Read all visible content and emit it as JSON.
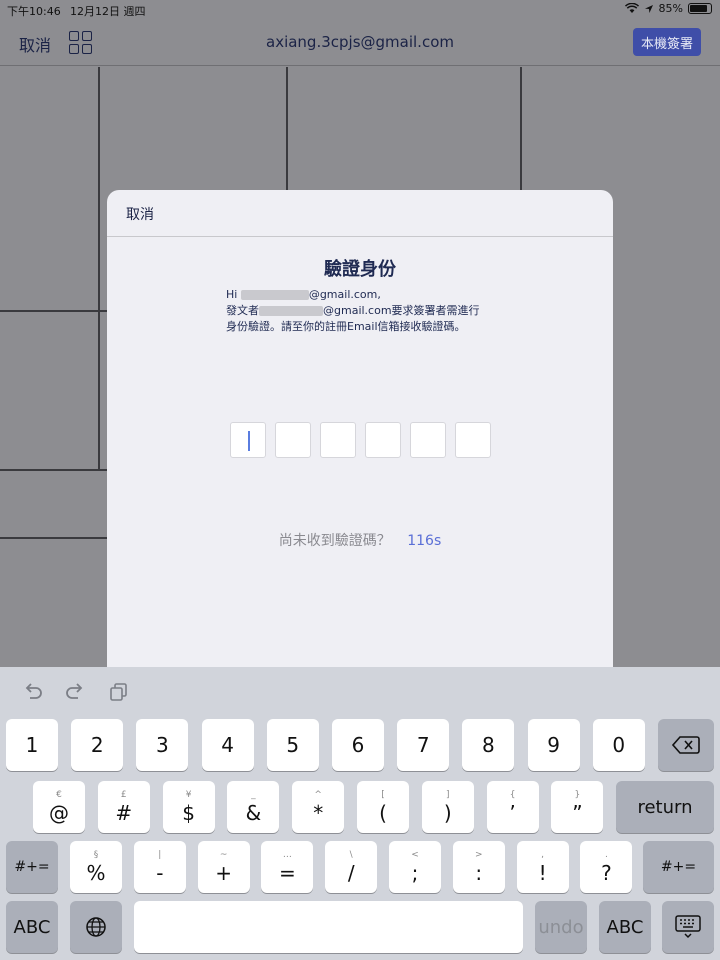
{
  "status": {
    "time": "下午10:46",
    "date": "12月12日 週四",
    "battery": "85%",
    "battery_level": 0.85
  },
  "nav": {
    "cancel": "取消",
    "title": "axiang.3cpjs@gmail.com",
    "local_sign": "本機簽署"
  },
  "modal": {
    "cancel": "取消",
    "title": "驗證身份",
    "msg_hi": "Hi",
    "msg_email_tail": "@gmail.com,",
    "msg_sender": "發文者",
    "msg_sender_tail": "@gmail.com要求簽署者需進行",
    "msg_line3": "身份驗證。請至你的註冊Email信箱接收驗證碼。",
    "code_length": 6,
    "resend_label": "尚未收到驗證碼？",
    "countdown": "116s"
  },
  "keyboard": {
    "row1": [
      "1",
      "2",
      "3",
      "4",
      "5",
      "6",
      "7",
      "8",
      "9",
      "0"
    ],
    "row2": [
      {
        "main": "@",
        "sub": "€"
      },
      {
        "main": "#",
        "sub": "£"
      },
      {
        "main": "$",
        "sub": "¥"
      },
      {
        "main": "&",
        "sub": "_"
      },
      {
        "main": "*",
        "sub": "^"
      },
      {
        "main": "(",
        "sub": "["
      },
      {
        "main": ")",
        "sub": "]"
      },
      {
        "main": "’",
        "sub": "{"
      },
      {
        "main": "”",
        "sub": "}"
      }
    ],
    "row3": [
      {
        "main": "%",
        "sub": "§"
      },
      {
        "main": "-",
        "sub": "|"
      },
      {
        "main": "+",
        "sub": "~"
      },
      {
        "main": "=",
        "sub": "…"
      },
      {
        "main": "/",
        "sub": "\\"
      },
      {
        "main": ";",
        "sub": "<"
      },
      {
        "main": ":",
        "sub": ">"
      },
      {
        "main": "!",
        "sub": ","
      },
      {
        "main": "?",
        "sub": "."
      }
    ],
    "return": "return",
    "symbols": "#+=",
    "abc": "ABC",
    "undo": "undo"
  },
  "icons": {
    "grid": "grid-icon",
    "backspace": "backspace-icon",
    "globe": "globe-icon",
    "hide_keyboard": "keyboard-dismiss-icon",
    "undo": "undo-icon",
    "redo": "redo-icon",
    "paste": "paste-icon"
  },
  "colors": {
    "accent_button": "#3f4ea8",
    "countdown": "#5a6fd6",
    "title": "#1f2a52"
  }
}
